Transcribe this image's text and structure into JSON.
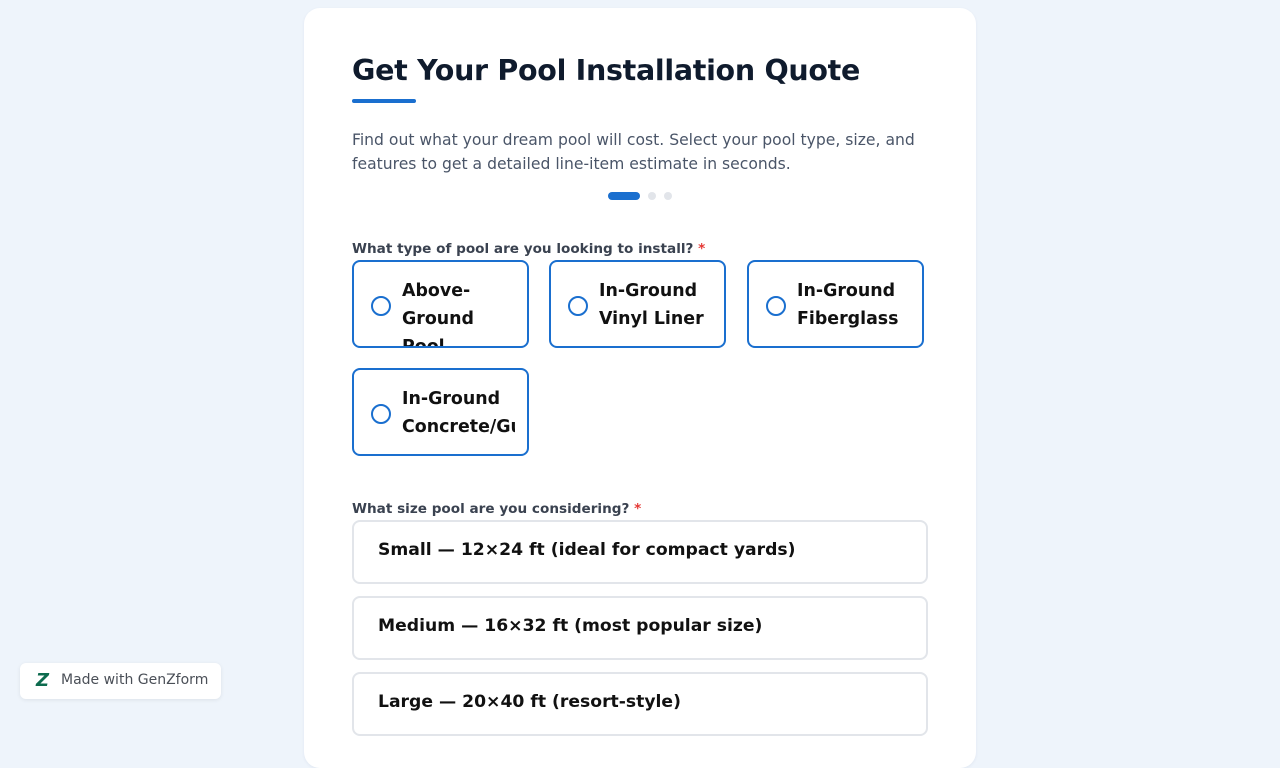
{
  "form": {
    "title": "Get Your Pool Installation Quote",
    "subtitle": "Find out what your dream pool will cost. Select your pool type, size, and features to get a detailed line-item estimate in seconds.",
    "accent_color": "#1a6fcf",
    "progress": {
      "current_step": 1,
      "total_steps": 3
    }
  },
  "pool_type": {
    "question": "What type of pool are you looking to install?",
    "required_mark": "*",
    "options": [
      {
        "label": "Above-\nGround Pool"
      },
      {
        "label": "In-Ground\nVinyl Liner"
      },
      {
        "label": "In-Ground\nFiberglass"
      },
      {
        "label": "In-Ground\nConcrete/Gunite"
      }
    ]
  },
  "pool_size": {
    "question": "What size pool are you considering?",
    "required_mark": "*",
    "options": [
      {
        "label": "Small — 12×24 ft (ideal for compact yards)"
      },
      {
        "label": "Medium — 16×32 ft (most popular size)"
      },
      {
        "label": "Large — 20×40 ft (resort-style)"
      }
    ]
  },
  "badge": {
    "logo_letter": "Z",
    "text": "Made with GenZform"
  }
}
